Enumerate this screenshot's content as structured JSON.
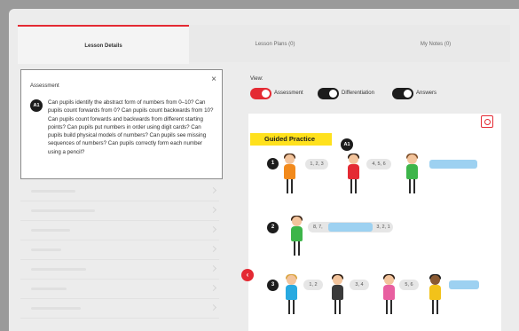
{
  "tabs": [
    {
      "label": "Lesson Details",
      "active": true
    },
    {
      "label": "Lesson Plans (0)",
      "active": false
    },
    {
      "label": "My Notes (0)",
      "active": false
    }
  ],
  "assessment_popup": {
    "title": "Assessment",
    "close_icon": "×",
    "badge": "A1",
    "text": "Can pupils identify the abstract form of numbers from 0–10? Can pupils count forwards from 0? Can pupils count backwards from 10? Can pupils count forwards and backwards from different starting points? Can pupils put numbers in order using digit cards? Can pupils build physical models of numbers? Can pupils see missing sequences of numbers? Can pupils correctly form each number using a pencil?"
  },
  "view": {
    "label": "View:",
    "toggles": [
      {
        "label": "Assessment",
        "on": true
      },
      {
        "label": "Differentiation",
        "on": false
      },
      {
        "label": "Answers",
        "on": false
      }
    ]
  },
  "worksheet": {
    "banner": "Guided Practice",
    "marker": "A1",
    "rows": [
      {
        "number": "1",
        "bubbles": [
          "1, 2, 3",
          "4, 5, 6"
        ]
      },
      {
        "number": "2",
        "bubbles": [
          "8, 7,",
          "3, 2, 1"
        ]
      },
      {
        "number": "3",
        "bubbles": [
          "1, 2",
          "3, 4",
          "5, 6"
        ]
      }
    ]
  },
  "colors": {
    "accent": "#e42a33",
    "banner": "#ffe11d",
    "answer_blur": "#9dd1f1"
  },
  "icons": {
    "expand": "expand-icon",
    "prev": "chevron-left-icon",
    "close": "close-icon"
  }
}
